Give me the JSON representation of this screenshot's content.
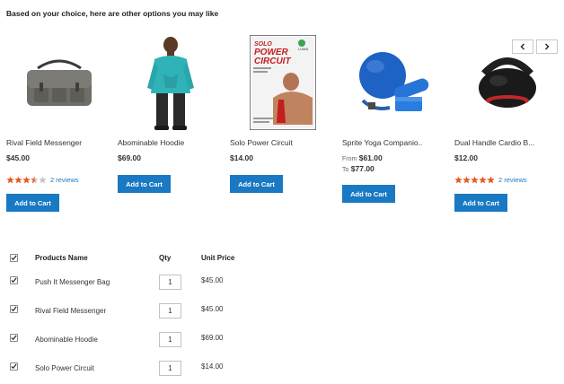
{
  "section": {
    "title": "Based on your choice, here are other options you may like"
  },
  "carousel": {
    "prev_icon": "chevron-left-icon",
    "next_icon": "chevron-right-icon"
  },
  "products": [
    {
      "name": "Rival Field Messenger",
      "price": "$45.00",
      "rating": 3.5,
      "reviews": "2 reviews",
      "add_label": "Add to Cart",
      "image": "messenger-bag-image"
    },
    {
      "name": "Abominable Hoodie",
      "price": "$69.00",
      "add_label": "Add to Cart",
      "image": "hoodie-model-image"
    },
    {
      "name": "Solo Power Circuit",
      "price": "$14.00",
      "add_label": "Add to Cart",
      "image": "dvd-cover-image",
      "cover_title_line1": "SOLO",
      "cover_title_line2": "POWER",
      "cover_title_line3": "CIRCUIT",
      "cover_brand": "LUMA"
    },
    {
      "name": "Sprite Yoga Companio..",
      "from_label": "From",
      "from_price": "$61.00",
      "to_label": "To",
      "to_price": "$77.00",
      "add_label": "Add to Cart",
      "image": "yoga-kit-image"
    },
    {
      "name": "Dual Handle Cardio B...",
      "price": "$12.00",
      "rating": 5,
      "reviews": "2 reviews",
      "add_label": "Add to Cart",
      "image": "kettlebell-image"
    }
  ],
  "table": {
    "headers": {
      "name": "Products Name",
      "qty": "Qty",
      "price": "Unit Price"
    },
    "rows": [
      {
        "name": "Push It Messenger Bag",
        "qty": "1",
        "price": "$45.00",
        "checked": true
      },
      {
        "name": "Rival Field Messenger",
        "qty": "1",
        "price": "$45.00",
        "checked": true
      },
      {
        "name": "Abominable Hoodie",
        "qty": "1",
        "price": "$69.00",
        "checked": true
      },
      {
        "name": "Solo Power Circuit",
        "qty": "1",
        "price": "$14.00",
        "checked": true
      }
    ]
  },
  "colors": {
    "accent": "#1979c3",
    "star": "#e85a1c",
    "star_empty": "#c7c7c7"
  }
}
